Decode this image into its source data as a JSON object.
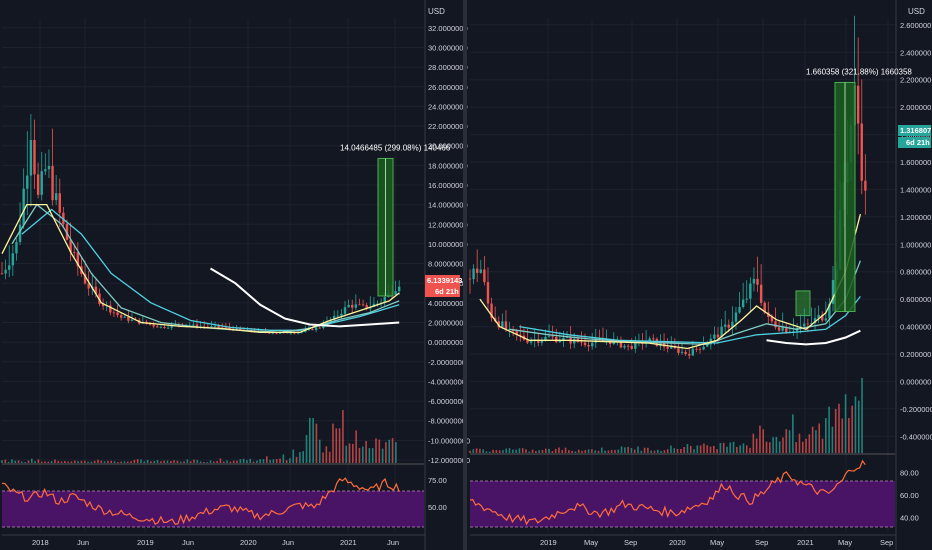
{
  "colors": {
    "background": "#131722",
    "grid": "#1e222d",
    "up": "#26a69a",
    "down": "#ef5350",
    "rsi_band": "#4a1466",
    "rsi_line": "#ff6d3a",
    "measure_fill": "#1b5e20",
    "measure_stroke": "#4caf50",
    "ma_fast": "#fff59d",
    "ma_mid": "#80cbc4",
    "ma_slow": "#4dd0e1",
    "ma_trend": "#ffffff"
  },
  "chart_data": [
    {
      "type": "line",
      "id": "left",
      "currency": "USD",
      "y_ticks": [
        "32.0000000",
        "30.0000000",
        "28.0000000",
        "26.0000000",
        "24.0000000",
        "22.0000000",
        "20.0000000",
        "18.0000000",
        "16.0000000",
        "14.0000000",
        "12.0000000",
        "10.0000000",
        "8.0000000",
        "6.0000000",
        "4.0000000",
        "2.0000000",
        "0.0000000",
        "-2.0000000",
        "-4.0000000",
        "-6.0000000",
        "-8.0000000",
        "-10.0000000",
        "-12.0000000"
      ],
      "ylim": [
        -12,
        33
      ],
      "x_ticks": [
        "2018",
        "Jun",
        "2019",
        "Jun",
        "2020",
        "Jun",
        "2021",
        "Jun"
      ],
      "price_badge": "6.1339143",
      "time_badge": "6d 21h",
      "measure_label": "14.0466485 (299.08%) 140466",
      "measure_range": [
        4.7,
        18.7
      ],
      "rsi_ticks": [
        "75.00",
        "50.00"
      ],
      "price_points": [
        [
          0,
          7
        ],
        [
          3,
          10
        ],
        [
          5,
          18
        ],
        [
          6,
          23
        ],
        [
          7,
          14
        ],
        [
          9,
          18
        ],
        [
          11,
          14
        ],
        [
          14,
          9
        ],
        [
          17,
          6
        ],
        [
          20,
          4
        ],
        [
          24,
          2.5
        ],
        [
          28,
          2
        ],
        [
          32,
          1.5
        ],
        [
          36,
          1.8
        ],
        [
          40,
          1.6
        ],
        [
          44,
          1.5
        ],
        [
          48,
          1.2
        ],
        [
          52,
          1.0
        ],
        [
          56,
          0.9
        ],
        [
          60,
          1.0
        ],
        [
          64,
          1.5
        ],
        [
          67,
          2.5
        ],
        [
          70,
          3.8
        ],
        [
          73,
          3.5
        ],
        [
          76,
          4.0
        ],
        [
          78,
          5.0
        ],
        [
          80,
          6.1
        ]
      ],
      "ma_fast": [
        [
          0,
          9
        ],
        [
          5,
          14
        ],
        [
          9,
          14
        ],
        [
          14,
          9
        ],
        [
          20,
          4
        ],
        [
          28,
          2
        ],
        [
          36,
          1.6
        ],
        [
          44,
          1.4
        ],
        [
          52,
          1.0
        ],
        [
          60,
          1.0
        ],
        [
          66,
          2.2
        ],
        [
          72,
          3.2
        ],
        [
          78,
          4.2
        ],
        [
          80,
          5.0
        ]
      ],
      "ma_mid": [
        [
          2,
          10
        ],
        [
          7,
          14
        ],
        [
          12,
          12
        ],
        [
          18,
          7
        ],
        [
          24,
          3.5
        ],
        [
          32,
          2
        ],
        [
          40,
          1.5
        ],
        [
          48,
          1.2
        ],
        [
          56,
          1.0
        ],
        [
          62,
          1.4
        ],
        [
          68,
          2.3
        ],
        [
          74,
          3.0
        ],
        [
          80,
          4.2
        ]
      ],
      "ma_slow": [
        [
          4,
          11
        ],
        [
          10,
          13.5
        ],
        [
          16,
          11
        ],
        [
          22,
          7
        ],
        [
          30,
          4
        ],
        [
          38,
          2.2
        ],
        [
          46,
          1.5
        ],
        [
          54,
          1.2
        ],
        [
          60,
          1.2
        ],
        [
          66,
          1.9
        ],
        [
          72,
          2.6
        ],
        [
          80,
          3.8
        ]
      ],
      "ma_trend": [
        [
          42,
          7.5
        ],
        [
          47,
          6
        ],
        [
          52,
          3.8
        ],
        [
          57,
          2.4
        ],
        [
          62,
          1.8
        ],
        [
          68,
          1.6
        ],
        [
          74,
          1.8
        ],
        [
          80,
          2.0
        ]
      ],
      "rsi_values": [
        70,
        62,
        58,
        64,
        55,
        60,
        54,
        48,
        45,
        42,
        40,
        38,
        36,
        40,
        44,
        48,
        50,
        46,
        42,
        44,
        48,
        52,
        50,
        62,
        75,
        70,
        65,
        72,
        68
      ],
      "volume": [
        0.04,
        0.03,
        0.05,
        0.03,
        0.04,
        0.03,
        0.03,
        0.04,
        0.03,
        0.03,
        0.05,
        0.04,
        0.03,
        0.04,
        0.04,
        0.03,
        0.05,
        0.04,
        0.06,
        0.05,
        0.08,
        0.1,
        0.15,
        0.6,
        0.3,
        0.9,
        0.5,
        0.25,
        0.4,
        0.3
      ]
    },
    {
      "type": "line",
      "id": "right",
      "currency": "USD",
      "y_ticks": [
        "2.600000",
        "2.400000",
        "2.200000",
        "2.000000",
        "1.800000",
        "1.600000",
        "1.400000",
        "1.200000",
        "1.000000",
        "0.800000",
        "0.600000",
        "0.400000",
        "0.200000",
        "0.000000",
        "-0.200000",
        "-0.400000"
      ],
      "ylim": [
        -0.5,
        2.65
      ],
      "x_ticks": [
        "2019",
        "May",
        "Sep",
        "2020",
        "May",
        "Sep",
        "2021",
        "May",
        "Sep"
      ],
      "price_badge": "1.316807",
      "time_badge": "6d 21h",
      "measure_label": "1.660358 (321.88%) 1660358",
      "measure_range": [
        0.51,
        2.18
      ],
      "rsi_ticks": [
        "80.00",
        "60.00",
        "40.00"
      ],
      "price_points": [
        [
          0,
          0.75
        ],
        [
          2,
          0.85
        ],
        [
          4,
          0.5
        ],
        [
          8,
          0.35
        ],
        [
          12,
          0.3
        ],
        [
          16,
          0.32
        ],
        [
          20,
          0.3
        ],
        [
          24,
          0.28
        ],
        [
          28,
          0.3
        ],
        [
          32,
          0.25
        ],
        [
          36,
          0.3
        ],
        [
          40,
          0.25
        ],
        [
          44,
          0.2
        ],
        [
          48,
          0.28
        ],
        [
          52,
          0.4
        ],
        [
          55,
          0.55
        ],
        [
          58,
          0.75
        ],
        [
          60,
          0.45
        ],
        [
          64,
          0.38
        ],
        [
          68,
          0.4
        ],
        [
          72,
          0.5
        ],
        [
          74,
          0.8
        ],
        [
          76,
          1.6
        ],
        [
          78,
          2.1
        ],
        [
          80,
          1.32
        ]
      ],
      "ma_fast": [
        [
          2,
          0.6
        ],
        [
          6,
          0.4
        ],
        [
          12,
          0.3
        ],
        [
          20,
          0.3
        ],
        [
          28,
          0.29
        ],
        [
          36,
          0.28
        ],
        [
          44,
          0.24
        ],
        [
          50,
          0.3
        ],
        [
          55,
          0.45
        ],
        [
          58,
          0.55
        ],
        [
          62,
          0.45
        ],
        [
          68,
          0.38
        ],
        [
          72,
          0.5
        ],
        [
          76,
          0.8
        ],
        [
          79,
          1.22
        ]
      ],
      "ma_mid": [
        [
          8,
          0.38
        ],
        [
          16,
          0.34
        ],
        [
          24,
          0.31
        ],
        [
          32,
          0.29
        ],
        [
          40,
          0.28
        ],
        [
          48,
          0.27
        ],
        [
          54,
          0.35
        ],
        [
          60,
          0.42
        ],
        [
          66,
          0.38
        ],
        [
          72,
          0.42
        ],
        [
          76,
          0.6
        ],
        [
          79,
          0.88
        ]
      ],
      "ma_slow": [
        [
          10,
          0.4
        ],
        [
          20,
          0.34
        ],
        [
          30,
          0.3
        ],
        [
          40,
          0.29
        ],
        [
          50,
          0.28
        ],
        [
          58,
          0.34
        ],
        [
          66,
          0.36
        ],
        [
          72,
          0.38
        ],
        [
          76,
          0.48
        ],
        [
          79,
          0.62
        ]
      ],
      "ma_trend": [
        [
          60,
          0.3
        ],
        [
          64,
          0.28
        ],
        [
          68,
          0.27
        ],
        [
          72,
          0.28
        ],
        [
          76,
          0.32
        ],
        [
          79,
          0.37
        ]
      ],
      "rsi_values": [
        55,
        50,
        45,
        40,
        38,
        36,
        40,
        45,
        50,
        48,
        44,
        46,
        52,
        50,
        48,
        46,
        44,
        48,
        52,
        58,
        70,
        60,
        55,
        62,
        72,
        78,
        70,
        65,
        60,
        70,
        85,
        88
      ],
      "volume": [
        0.05,
        0.04,
        0.06,
        0.05,
        0.04,
        0.05,
        0.06,
        0.05,
        0.05,
        0.06,
        0.07,
        0.08,
        0.06,
        0.07,
        0.08,
        0.12,
        0.1,
        0.12,
        0.2,
        0.15,
        0.3,
        0.25,
        0.4,
        0.2,
        0.35,
        0.6,
        0.9,
        1.0
      ]
    }
  ]
}
